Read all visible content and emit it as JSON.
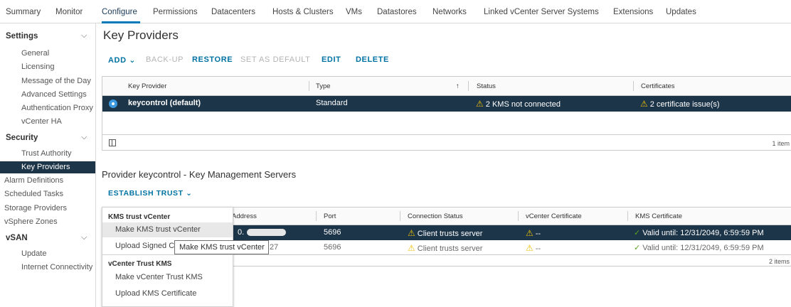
{
  "top_tabs": [
    "Summary",
    "Monitor",
    "Configure",
    "Permissions",
    "Datacenters",
    "Hosts & Clusters",
    "VMs",
    "Datastores",
    "Networks",
    "Linked vCenter Server Systems",
    "Extensions",
    "Updates"
  ],
  "sidebar": {
    "settings_label": "Settings",
    "settings_items": [
      "General",
      "Licensing",
      "Message of the Day",
      "Advanced Settings",
      "Authentication Proxy",
      "vCenter HA"
    ],
    "security_label": "Security",
    "security_items": [
      "Trust Authority",
      "Key Providers"
    ],
    "top_items": [
      "Alarm Definitions",
      "Scheduled Tasks",
      "Storage Providers",
      "vSphere Zones"
    ],
    "vsan_label": "vSAN",
    "vsan_items": [
      "Update",
      "Internet Connectivity"
    ]
  },
  "page": {
    "title": "Key Providers",
    "actions": [
      "ADD",
      "BACK-UP",
      "RESTORE",
      "SET AS DEFAULT",
      "EDIT",
      "DELETE"
    ]
  },
  "providers_grid": {
    "columns": [
      "Key Provider",
      "Type",
      "Status",
      "Certificates"
    ],
    "rows": [
      {
        "provider": "keycontrol (default)",
        "type": "Standard",
        "status": "2 KMS not connected",
        "certificates": "2 certificate issue(s)"
      }
    ],
    "footer_count": "1 item"
  },
  "kms": {
    "title": "Provider keycontrol - Key Management Servers",
    "establish_label": "ESTABLISH TRUST",
    "columns": [
      "Address",
      "Port",
      "Connection Status",
      "vCenter Certificate",
      "KMS Certificate"
    ],
    "rows": [
      {
        "address": "0.",
        "port": "5696",
        "status": "Client trusts server",
        "vcenter_cert": "--",
        "kms_cert": "Valid until: 12/31/2049, 6:59:59 PM"
      },
      {
        "address": "27",
        "port": "5696",
        "status": "Client trusts server",
        "vcenter_cert": "--",
        "kms_cert": "Valid until: 12/31/2049, 6:59:59 PM"
      }
    ],
    "footer_count": "2 items"
  },
  "dropdown": {
    "header1": "KMS trust vCenter",
    "item1": "Make KMS trust vCenter",
    "item2": "Upload Signed C",
    "header2": "vCenter Trust KMS",
    "item3": "Make vCenter Trust KMS",
    "item4": "Upload KMS Certificate"
  },
  "tooltip": "Make KMS trust vCenter",
  "colors": {
    "accent": "#0072a3",
    "selected_row": "#1d3549",
    "warning": "#efc006",
    "ok": "#5aa220"
  }
}
